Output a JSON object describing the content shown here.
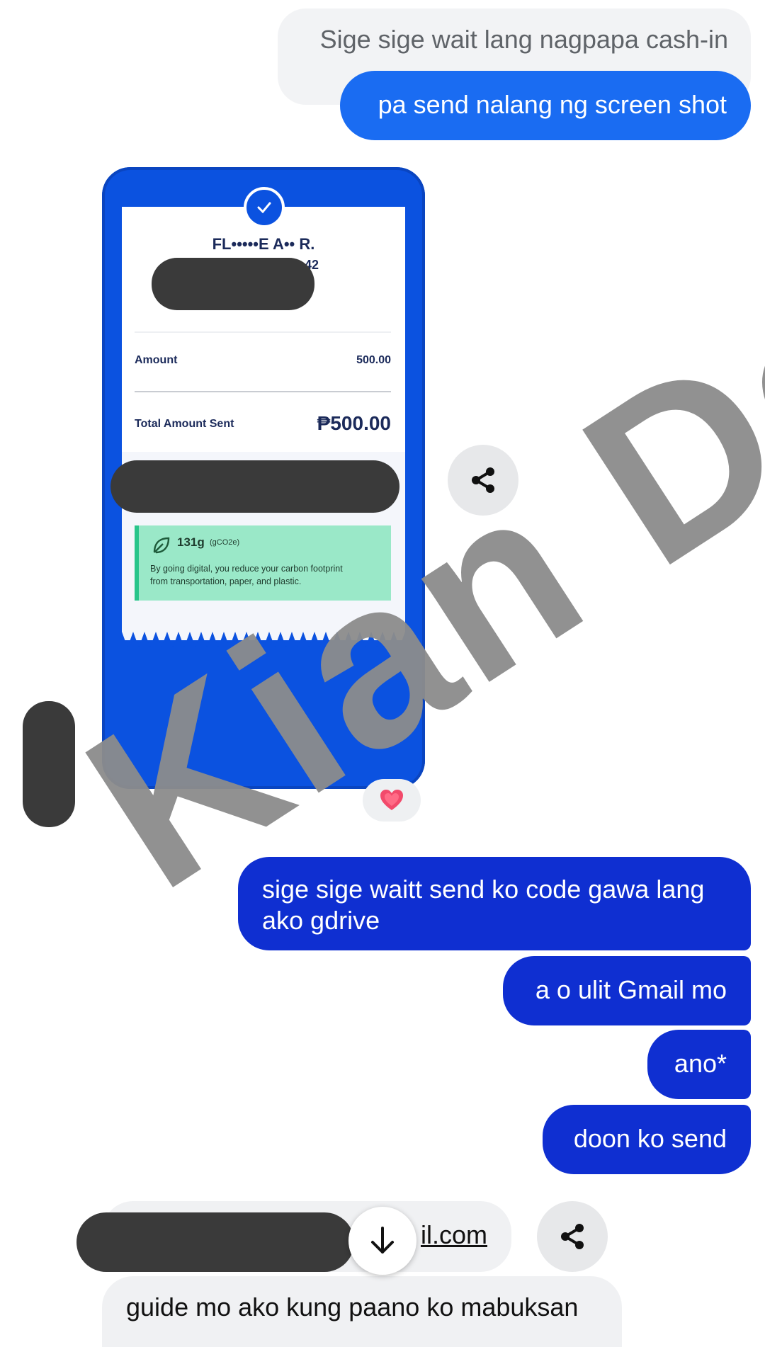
{
  "messages": {
    "quoted_reply": "Sige sige wait lang nagpapa cash-in",
    "request_screenshot": "pa send nalang ng screen shot",
    "msg_gdrive": "sige sige waitt send ko code gawa lang ako gdrive",
    "msg_gmail": "a o ulit Gmail mo",
    "msg_ano": "ano*",
    "msg_doon": "doon ko send",
    "email_suffix": "il.com",
    "guide_partial": "guide mo ako kung paano ko mabuksan"
  },
  "receipt": {
    "recipient_name": "FL•••••E A•• R.",
    "number_suffix": "42",
    "amount_label": "Amount",
    "amount_value": "500.00",
    "total_label": "Total Amount Sent",
    "total_value": "₱500.00",
    "carbon_value": "131g",
    "carbon_unit": "(gCO2e)",
    "carbon_note_line1": "By going digital, you reduce your carbon footprint",
    "carbon_note_line2": "from transportation, paper, and plastic."
  },
  "reaction": "heart-emoji",
  "watermark_text": "Kian Dev",
  "icons": [
    "share-icon",
    "check-icon",
    "leaf-icon",
    "arrow-down-icon",
    "heart-icon"
  ],
  "colors": {
    "sent_light": "#1a6cf2",
    "sent_dark": "#0f2fd1",
    "receipt_blue": "#0b52e0",
    "carbon_green": "#9ae8c8",
    "watermark_gray": "#8c8c8c"
  }
}
